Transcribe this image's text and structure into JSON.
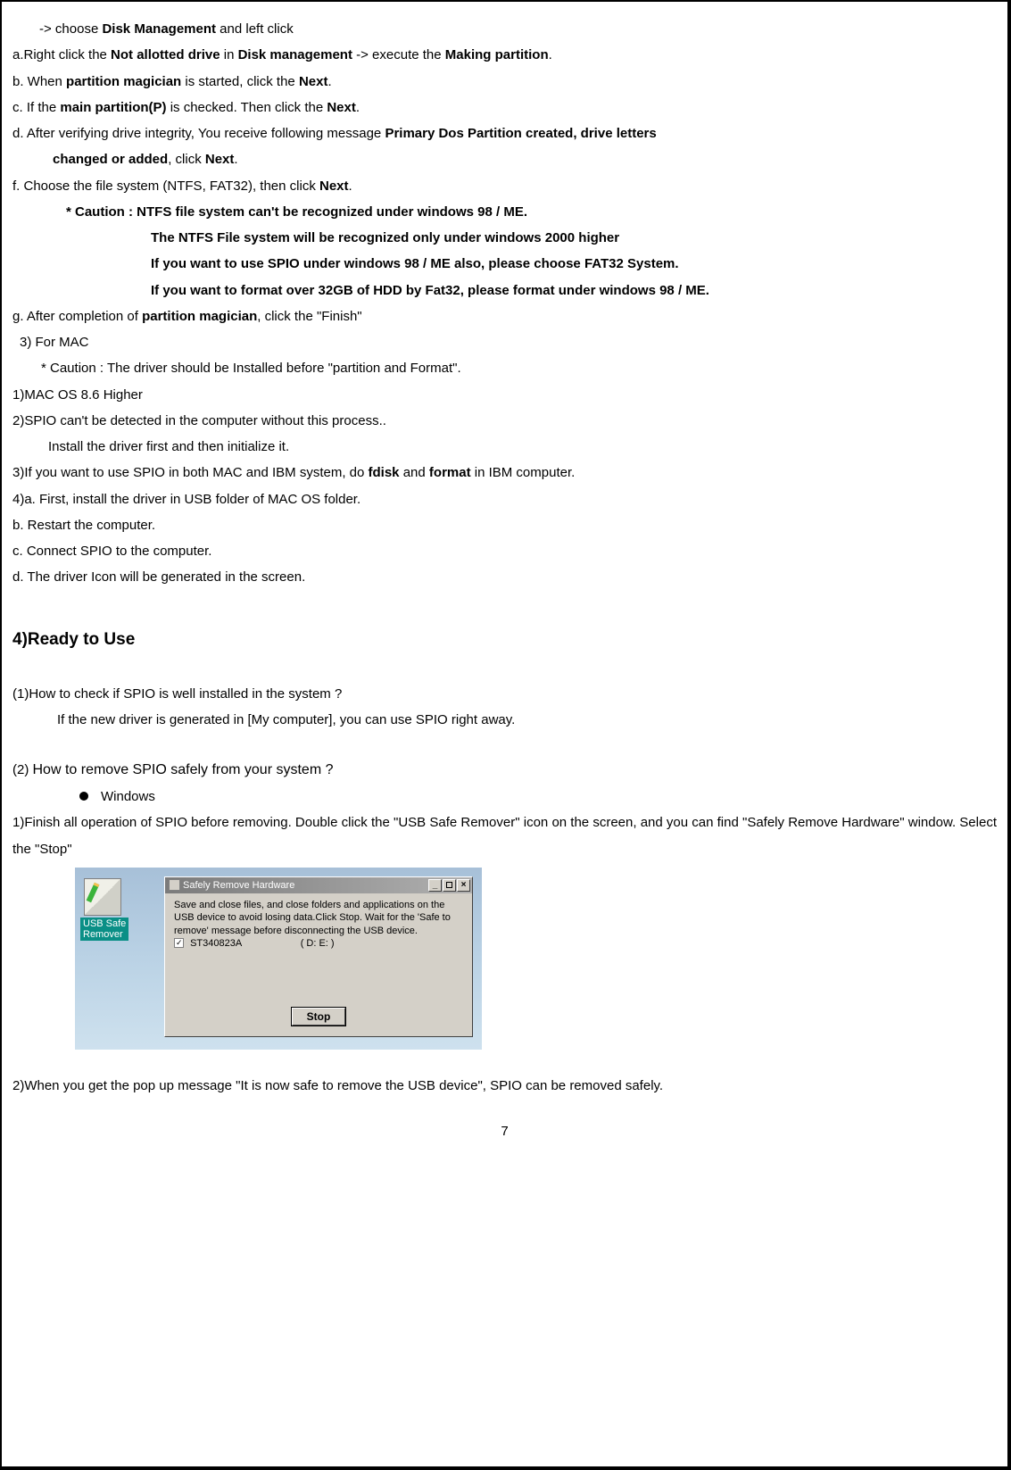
{
  "page_number": "7",
  "t": {
    "l1": {
      "pre": "-> choose ",
      "b1": "Disk Management",
      "post": " and left click"
    },
    "l2": {
      "pre": "a.Right click the ",
      "b1": "Not allotted drive",
      "mid1": " in ",
      "b2": "Disk management",
      "mid2": " -> execute the ",
      "b3": "Making partition",
      "end": "."
    },
    "l3": {
      "pre": "b. When ",
      "b1": "partition magician",
      "mid": " is started, click the ",
      "b2": "Next",
      "end": "."
    },
    "l4": {
      "pre": "c. If the ",
      "b1": "main partition(P)",
      "mid": " is checked. Then click the ",
      "b2": "Next",
      "end": "."
    },
    "l5": {
      "pre": "d. After verifying drive integrity, You receive following message ",
      "b1": "Primary Dos Partition created, drive letters"
    },
    "l6": {
      "b1": "changed or added",
      "mid": ", click ",
      "b2": "Next",
      "end": "."
    },
    "l7": {
      "pre": "f. Choose the file system (NTFS, FAT32), then click ",
      "b1": "Next",
      "end": "."
    },
    "l8": "* Caution : NTFS file system can't be recognized under windows 98 / ME.",
    "l9": "The NTFS File system will be recognized only under windows 2000 higher",
    "l10": "If you want to use SPIO under windows 98 / ME also, please choose FAT32 System.",
    "l11": "If you want to format over 32GB of HDD by Fat32, please format under windows 98 / ME.",
    "l12": {
      "pre": "g. After completion of ",
      "b1": "partition magician",
      "post": ", click the \"Finish\""
    },
    "l13": "3) For MAC",
    "l14": "* Caution : The driver should be Installed before \"partition and Format\".",
    "l15": "1)MAC OS 8.6 Higher",
    "l16": "2)SPIO can't be detected in the computer without this process..",
    "l17": "Install the driver first and then initialize it.",
    "l18": {
      "pre": "3)If you want to use SPIO in both MAC and IBM system, do ",
      "b1": "fdisk",
      "mid": " and ",
      "b2": "format",
      "post": " in IBM computer."
    },
    "l19": "4)a. First, install the driver in USB folder of MAC OS folder.",
    "l20": "b. Restart the computer.",
    "l21": "c. Connect SPIO to the computer.",
    "l22": "d. The driver Icon will be generated in the screen."
  },
  "s4": {
    "title": "4)Ready to Use",
    "q1_a": "(1)How to check if SPIO is well installed in the system ?",
    "q1_b": "If the new driver is generated in [My computer], you can use SPIO right away.",
    "q2_lead": "(2) ",
    "q2_text": "How to remove SPIO safely from your system ?",
    "bullet1": "Windows",
    "p1": "1)Finish all operation of SPIO before removing. Double click the \"USB Safe Remover\" icon on the screen, and you can find \"Safely Remove Hardware\" window. Select the \"Stop\"",
    "p2": "2)When you get the pop up message \"It is now safe to remove the USB device\", SPIO can be removed safely."
  },
  "shot": {
    "remover_label": "USB Safe\nRemover",
    "title": "Safely Remove Hardware",
    "body": "Save and close files, and close folders and applications on the USB device to avoid losing data.Click Stop. Wait for the 'Safe to remove' message before disconnecting the USB device.",
    "device": "ST340823A",
    "drives": "( D: E: )",
    "stop": "Stop",
    "min": "_",
    "close": "×"
  }
}
